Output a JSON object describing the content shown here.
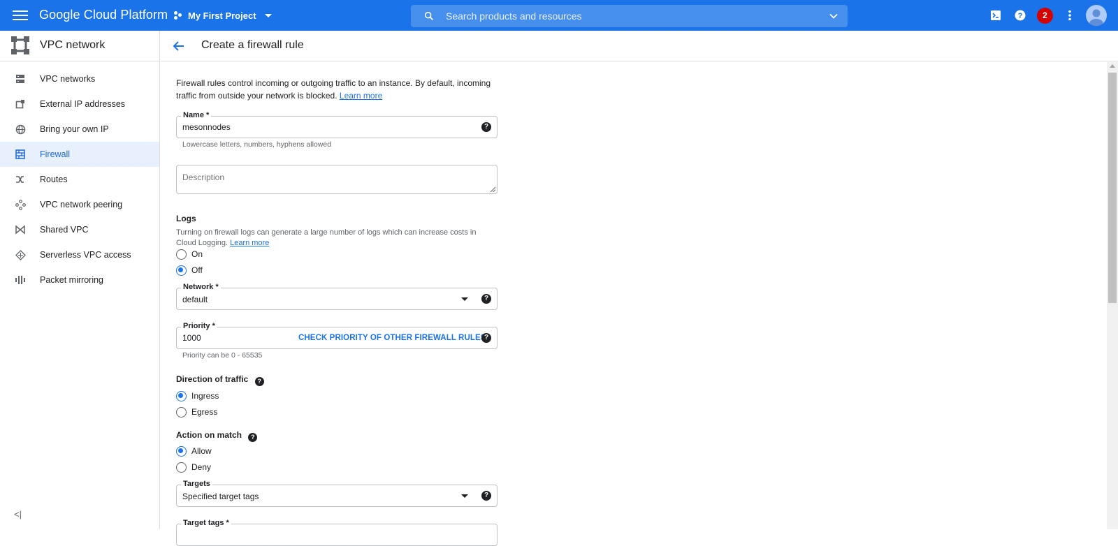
{
  "topbar": {
    "brand": "Google Cloud Platform",
    "project": "My First Project",
    "search_placeholder": "Search products and resources",
    "notification_count": "2",
    "colors": {
      "bar": "#1a73e8",
      "notification": "#d50000"
    }
  },
  "sidebar": {
    "title": "VPC network",
    "items": [
      {
        "label": "VPC networks",
        "icon": "vpc-networks-icon"
      },
      {
        "label": "External IP addresses",
        "icon": "external-ip-icon"
      },
      {
        "label": "Bring your own IP",
        "icon": "globe-icon"
      },
      {
        "label": "Firewall",
        "icon": "firewall-icon",
        "active": true
      },
      {
        "label": "Routes",
        "icon": "routes-icon"
      },
      {
        "label": "VPC network peering",
        "icon": "peering-icon"
      },
      {
        "label": "Shared VPC",
        "icon": "shared-vpc-icon"
      },
      {
        "label": "Serverless VPC access",
        "icon": "serverless-icon"
      },
      {
        "label": "Packet mirroring",
        "icon": "packet-mirroring-icon"
      }
    ],
    "collapse_glyph": "<|"
  },
  "header": {
    "title": "Create a firewall rule"
  },
  "form": {
    "intro_text": "Firewall rules control incoming or outgoing traffic to an instance. By default, incoming traffic from outside your network is blocked.",
    "learn_more": "Learn more",
    "name": {
      "label": "Name *",
      "value": "mesonnodes",
      "hint": "Lowercase letters, numbers, hyphens allowed"
    },
    "description": {
      "placeholder": "Description"
    },
    "logs": {
      "label": "Logs",
      "text": "Turning on firewall logs can generate a large number of logs which can increase costs in Cloud Logging.",
      "learn_more": "Learn more",
      "options": [
        "On",
        "Off"
      ],
      "selected": "Off"
    },
    "network": {
      "label": "Network *",
      "value": "default"
    },
    "priority": {
      "label": "Priority *",
      "value": "1000",
      "action": "CHECK PRIORITY OF OTHER FIREWALL RULES",
      "hint": "Priority can be 0 - 65535"
    },
    "direction": {
      "label": "Direction of traffic",
      "options": [
        "Ingress",
        "Egress"
      ],
      "selected": "Ingress"
    },
    "action": {
      "label": "Action on match",
      "options": [
        "Allow",
        "Deny"
      ],
      "selected": "Allow"
    },
    "targets": {
      "label": "Targets",
      "value": "Specified target tags"
    },
    "target_tags": {
      "label": "Target tags *"
    },
    "help_glyph": "?"
  }
}
